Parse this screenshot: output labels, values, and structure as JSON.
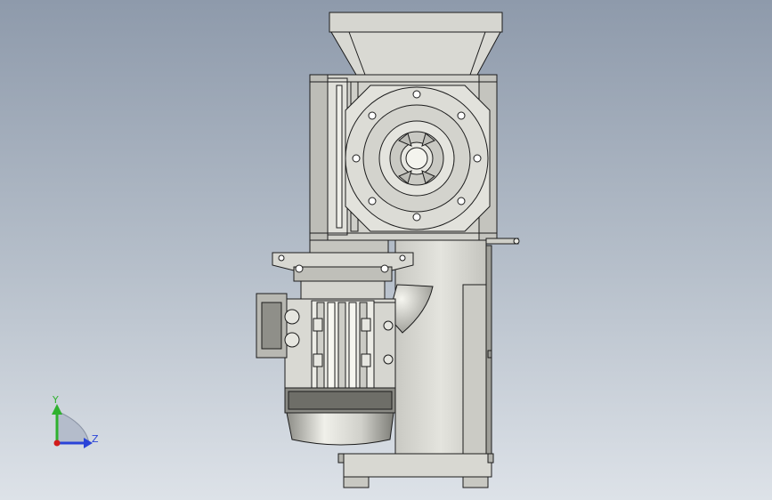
{
  "viewport": {
    "background_top": "#8e9aab",
    "background_bottom": "#dde2e8"
  },
  "model": {
    "part_colors": {
      "body": "#dcdcd6",
      "shadow": "#a9a9a3",
      "outline": "#1c1c1c",
      "metal": "#c7c7c1"
    }
  },
  "triad": {
    "y_label": "Y",
    "z_label": "Z",
    "y_color": "#2fb12f",
    "z_color": "#2a44d8",
    "origin_color": "#d21b1b"
  }
}
